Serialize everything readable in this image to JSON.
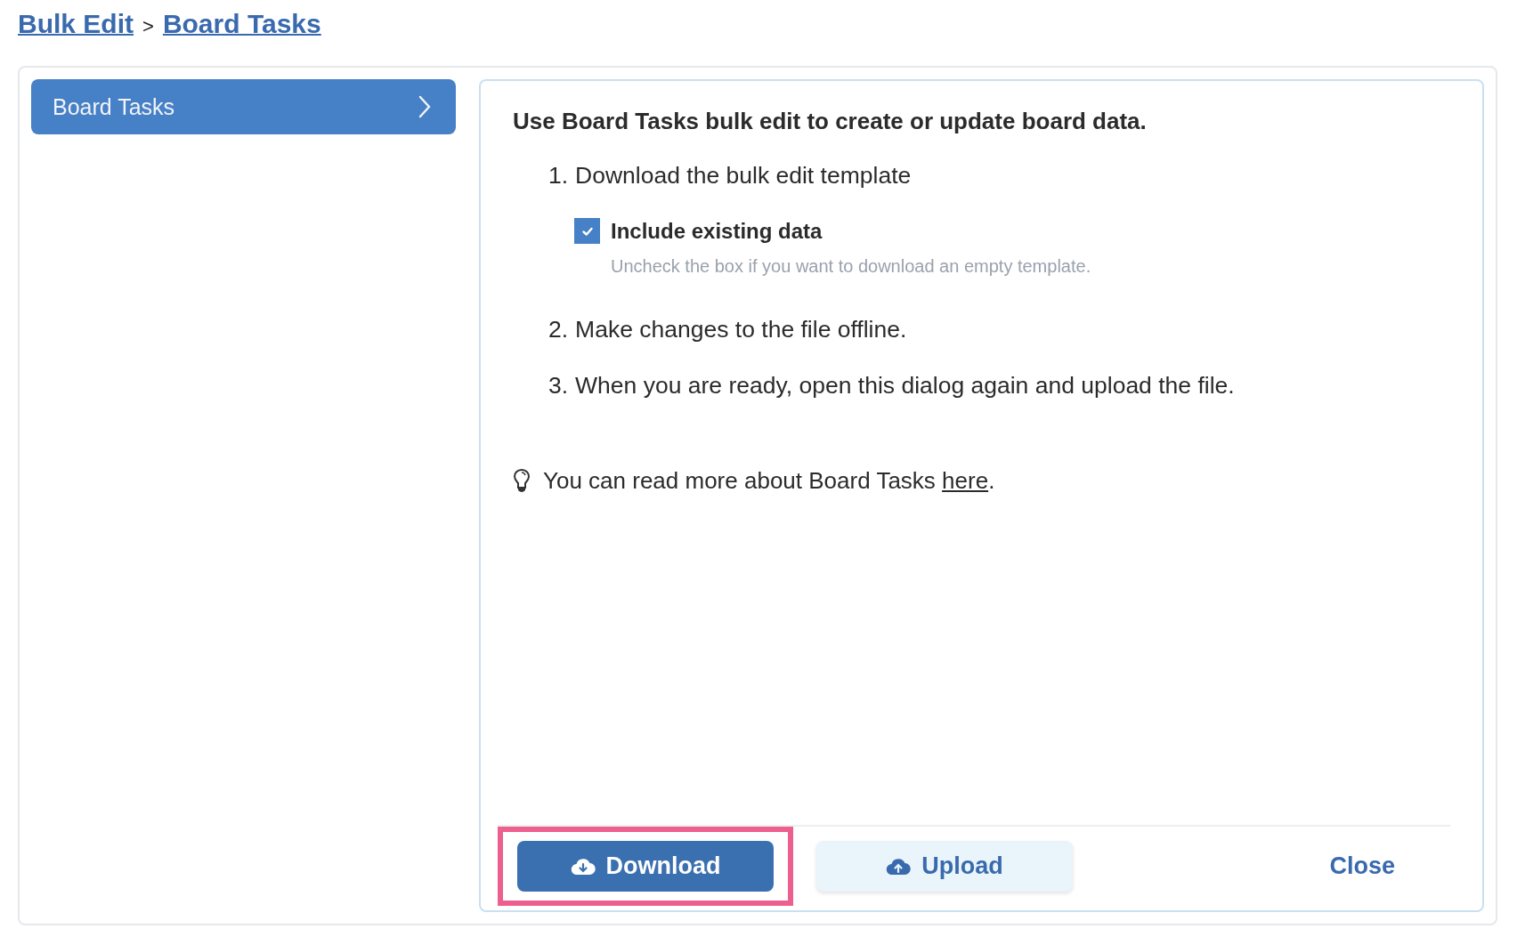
{
  "breadcrumb": {
    "items": [
      {
        "label": "Bulk Edit"
      },
      {
        "label": "Board Tasks"
      }
    ],
    "separator": ">"
  },
  "sidebar": {
    "items": [
      {
        "label": "Board Tasks",
        "selected": true
      }
    ]
  },
  "content": {
    "heading": "Use Board Tasks bulk edit to create or update board data.",
    "steps": [
      {
        "number": "1.",
        "text": "Download the bulk edit template"
      },
      {
        "number": "2.",
        "text": "Make changes to the file offline."
      },
      {
        "number": "3.",
        "text": "When you are ready, open this dialog again and upload the file."
      }
    ],
    "option": {
      "label": "Include existing data",
      "checked": true,
      "hint": "Uncheck the box if you want to download an empty template."
    },
    "tip": {
      "text": "You can read more about Board Tasks ",
      "link": "here",
      "end": "."
    }
  },
  "footer": {
    "buttons": [
      {
        "label": "Download",
        "kind": "primary",
        "highlighted": true
      },
      {
        "label": "Upload",
        "kind": "secondary",
        "highlighted": false
      },
      {
        "label": "Close",
        "kind": "link",
        "highlighted": false
      }
    ]
  }
}
